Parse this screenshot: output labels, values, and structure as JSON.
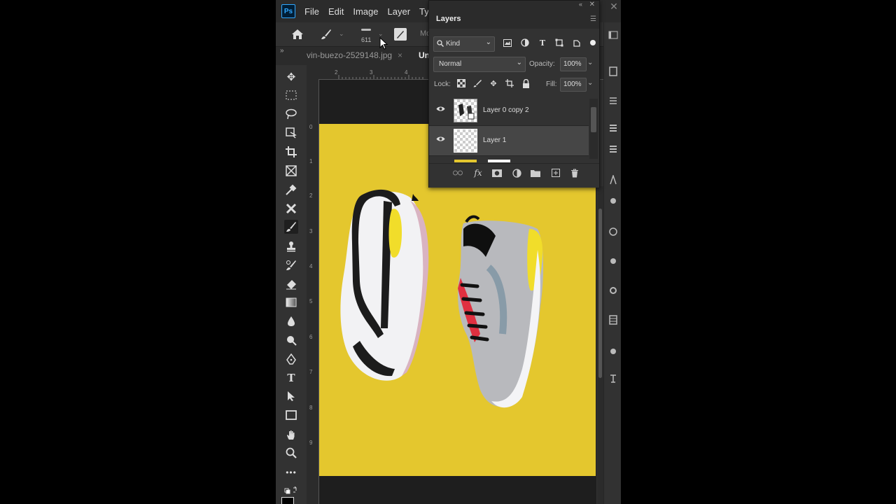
{
  "menubar": {
    "logo": "Ps",
    "items": [
      "File",
      "Edit",
      "Image",
      "Layer",
      "Type"
    ],
    "close_glyph": "✕"
  },
  "options": {
    "brush_size": "611",
    "mode_label": "Mo"
  },
  "tabs": {
    "expand_glyph": "»",
    "file_tab": "vin-buezo-2529148.jpg",
    "close_glyph": "×",
    "active_tab": "Un"
  },
  "ruler": {
    "h_ticks": [
      "2",
      "3",
      "4"
    ],
    "v_ticks": [
      "0",
      "1",
      "2",
      "3",
      "4",
      "5",
      "6",
      "7",
      "8",
      "9"
    ]
  },
  "layers_panel": {
    "title": "Layers",
    "collapse_glyph": "«",
    "close_glyph": "✕",
    "filter_kind": "Kind",
    "blend_mode": "Normal",
    "opacity_label": "Opacity:",
    "opacity_value": "100%",
    "lock_label": "Lock:",
    "fill_label": "Fill:",
    "fill_value": "100%",
    "layers": [
      {
        "name": "Layer 0 copy 2",
        "selected": false,
        "visible": true
      },
      {
        "name": "Layer 1",
        "selected": true,
        "visible": true
      }
    ]
  },
  "colors": {
    "canvas_yellow": "#e4c72e",
    "app_bg": "#323232",
    "ps_blue": "#31a8ff"
  }
}
